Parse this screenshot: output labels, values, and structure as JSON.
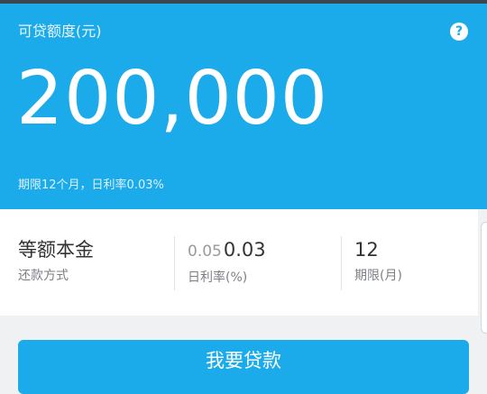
{
  "hero": {
    "label": "可贷额度(元)",
    "amount": "200,000",
    "terms": "期限12个月，日利率0.03%",
    "help_icon": "question-circle-icon"
  },
  "details": {
    "repayment": {
      "value": "等额本金",
      "label": "还款方式"
    },
    "rate": {
      "old_value": "0.05",
      "value": "0.03",
      "label": "日利率(%)"
    },
    "term": {
      "value": "12",
      "label": "期限(月)"
    }
  },
  "action": {
    "label": "我要贷款"
  },
  "colors": {
    "accent": "#1baaea",
    "text_primary": "#333333",
    "text_secondary": "#7b7f85",
    "page_background": "#f0f1f3"
  }
}
